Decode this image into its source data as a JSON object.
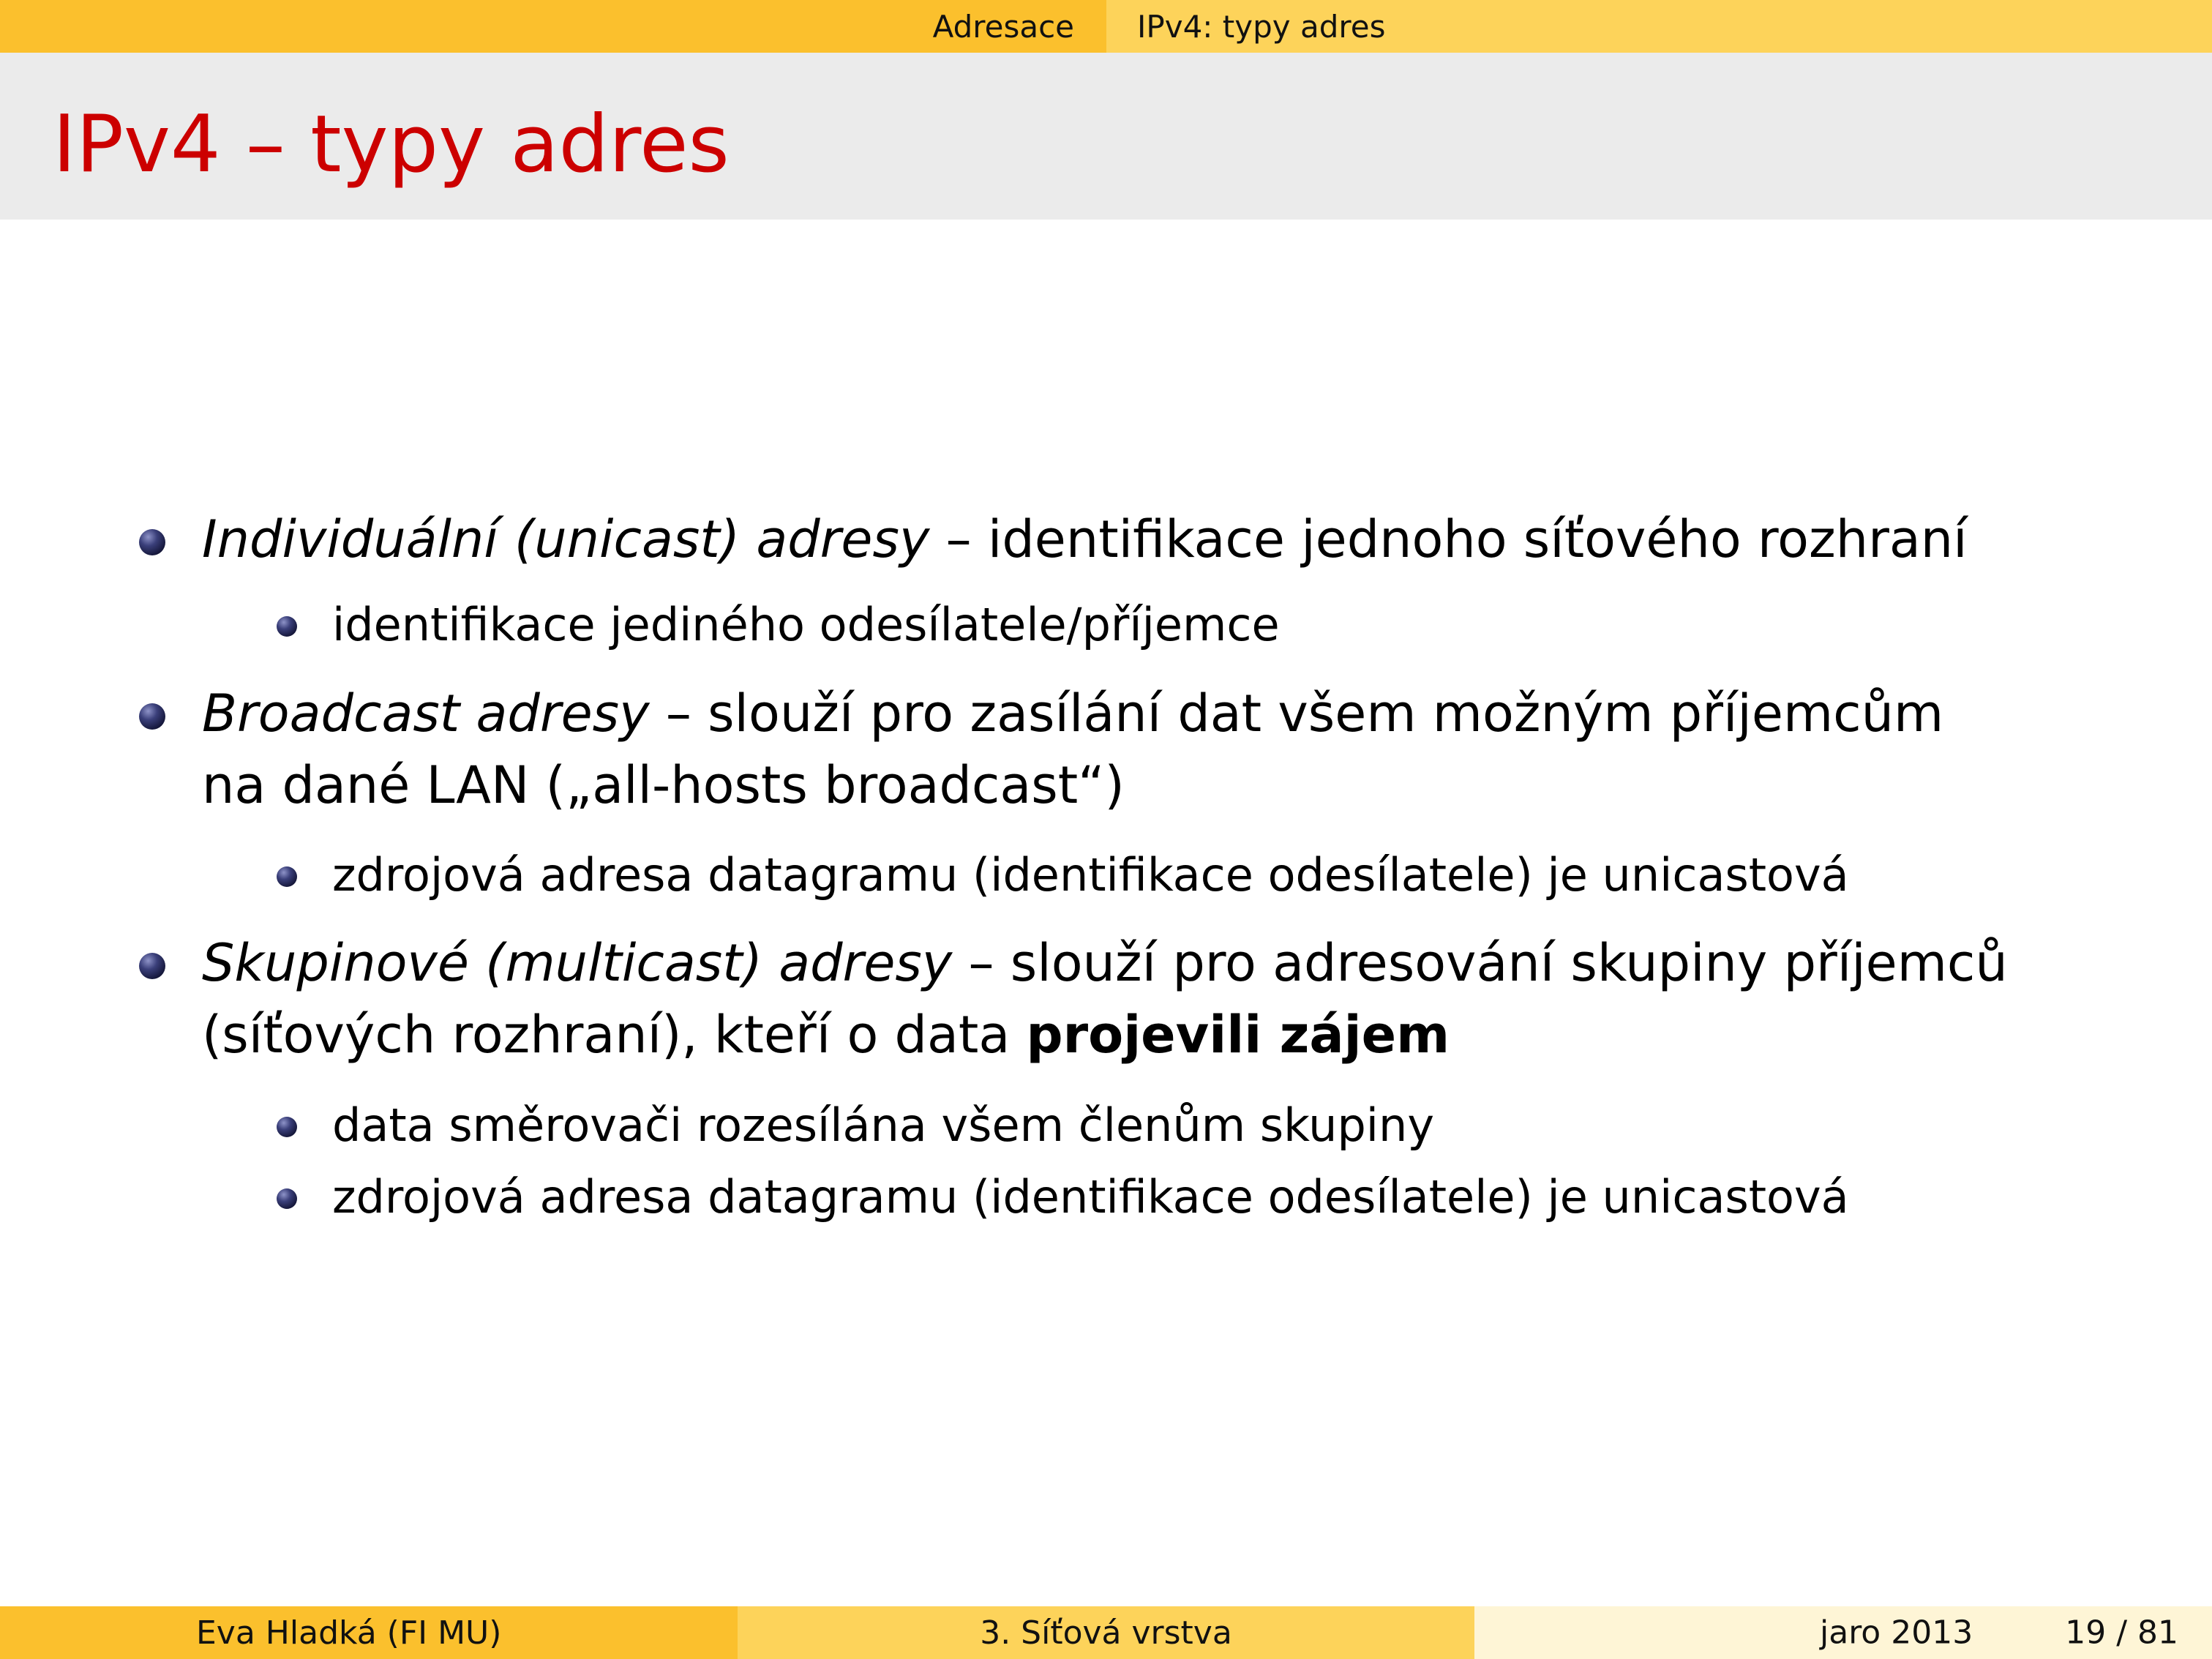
{
  "nav": {
    "section": "Adresace",
    "subsection": "IPv4: typy adres"
  },
  "title": "IPv4 – typy adres",
  "items": [
    {
      "term": "Individuální (unicast) adresy",
      "desc": " – identifikace jednoho síťového rozhraní",
      "sub": [
        "identifikace jediného odesílatele/příjemce"
      ]
    },
    {
      "term": "Broadcast adresy",
      "desc": " – slouží pro zasílání dat všem možným příjemcům",
      "desc2": "na dané LAN („all-hosts broadcast“)",
      "sub": [
        "zdrojová adresa datagramu (identifikace odesílatele) je unicastová"
      ]
    },
    {
      "term": "Skupinové (multicast) adresy",
      "desc": " – slouží pro adresování skupiny příjemců",
      "desc2": "(síťových rozhraní), kteří o data ",
      "desc2_bold": "projevili zájem",
      "sub": [
        "data směrovači rozesílána všem členům skupiny",
        "zdrojová adresa datagramu (identifikace odesílatele) je unicastová"
      ]
    }
  ],
  "footer": {
    "author": "Eva Hladká  (FI MU)",
    "chapter": "3. Síťová vrstva",
    "date": "jaro 2013",
    "page": "19 / 81"
  }
}
